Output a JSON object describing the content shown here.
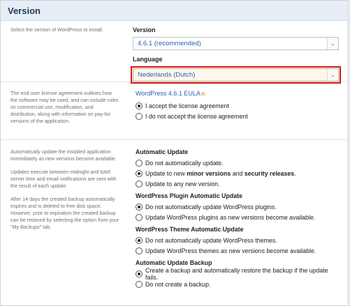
{
  "header": {
    "title": "Version"
  },
  "version_section": {
    "description": "Select the version of WordPress to install.",
    "version_label": "Version",
    "version_value": "4.6.1 (recommended)",
    "language_label": "Language",
    "language_value": "Nederlands (Dutch)"
  },
  "eula_section": {
    "description": "The end user license agreement outlines how the software may be used, and can include rules on commercial use, modification, and distribution, along with information on pay-for versions of the application.",
    "link_label": "WordPress 4.6.1 EULA",
    "accept_label": "I accept the license agreement",
    "decline_label": "I do not accept the license agreement"
  },
  "update_section": {
    "descriptions": [
      "Automatically update the installed application immediately as new versions become available.",
      "Updates execute between midnight and 6AM server time and email notifications are sent with the result of each update.",
      "After 14 days the created backup automatically expires and is deleted to free disk space. However, prior to expiration the created backup can be retained by selecting the option from your \"My Backups\" tab."
    ],
    "automatic_update": {
      "title": "Automatic Update",
      "opt1": "Do not automatically update.",
      "opt2_prefix": "Update to new ",
      "opt2_bold1": "minor versions",
      "opt2_mid": " and ",
      "opt2_bold2": "security releases",
      "opt2_suffix": ".",
      "opt3": "Update to any new version."
    },
    "plugin_update": {
      "title": "WordPress Plugin Automatic Update",
      "opt1": "Do not automatically update WordPress plugins.",
      "opt2": "Update WordPress plugins as new versions become available."
    },
    "theme_update": {
      "title": "WordPress Theme Automatic Update",
      "opt1": "Do not automatically update WordPress themes.",
      "opt2": "Update WordPress themes as new versions become available."
    },
    "backup": {
      "title": "Automatic Update Backup",
      "opt1": "Create a backup and automatically restore the backup if the update fails.",
      "opt2": "Do not create a backup."
    }
  },
  "icons": {
    "dropdown": "chevron-down-icon",
    "external": "external-link-icon"
  },
  "colors": {
    "header_bg": "#e7eef5",
    "link": "#2a62b4",
    "highlight": "#d11a1a"
  }
}
